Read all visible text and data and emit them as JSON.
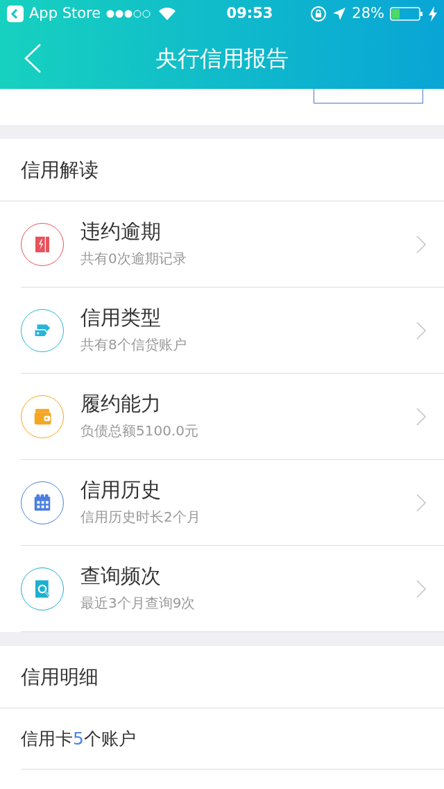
{
  "status_bar": {
    "back_app": "App Store",
    "time": "09:53",
    "battery": "28%"
  },
  "nav": {
    "title": "央行信用报告"
  },
  "sections": [
    {
      "title": "信用解读",
      "items": [
        {
          "title": "违约逾期",
          "subtitle": "共有0次逾期记录",
          "color": "#e8525a"
        },
        {
          "title": "信用类型",
          "subtitle": "共有8个信贷账户",
          "color": "#2bb3d9"
        },
        {
          "title": "履约能力",
          "subtitle": "负债总额5100.0元",
          "color": "#f5a623"
        },
        {
          "title": "信用历史",
          "subtitle": "信用历史时长2个月",
          "color": "#4a7fe0"
        },
        {
          "title": "查询频次",
          "subtitle": "最近3个月查询9次",
          "color": "#1cb0d0"
        }
      ]
    },
    {
      "title": "信用明细",
      "rows": [
        {
          "before": "信用卡",
          "count": "5",
          "after": "个账户"
        }
      ]
    }
  ]
}
